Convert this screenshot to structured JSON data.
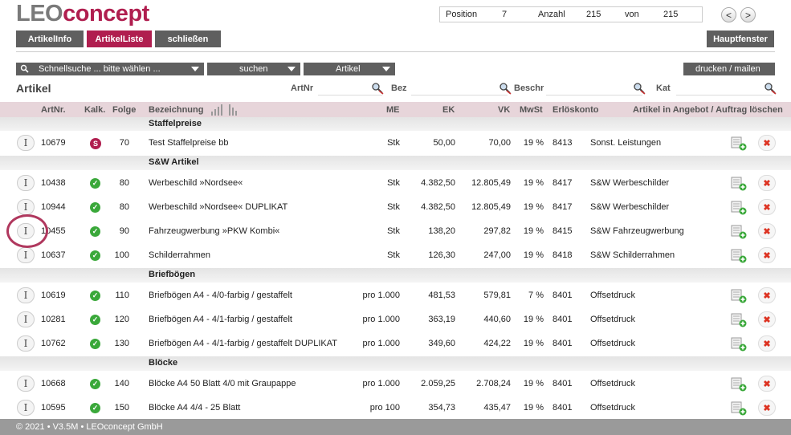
{
  "app": {
    "logo_part1": "LEO",
    "logo_part2": "concept"
  },
  "nav": {
    "position_label": "Position",
    "position_value": "7",
    "anzahl_label": "Anzahl",
    "anzahl_value": "215",
    "von_label": "von",
    "von_value": "215",
    "prev": "<",
    "next": ">"
  },
  "tabs": {
    "artikelinfo": "ArtikelInfo",
    "artikelliste": "ArtikelListe",
    "schliessen": "schließen",
    "hauptfenster": "Hauptfenster"
  },
  "toolbar": {
    "schnellsuche": "Schnellsuche ... bitte wählen ...",
    "suchen": "suchen",
    "artikel": "Artikel",
    "drucken": "drucken / mailen"
  },
  "search": {
    "title": "Artikel",
    "artnr": "ArtNr",
    "bez": "Bez",
    "beschr": "Beschr",
    "kat": "Kat"
  },
  "columns": {
    "artnr": "ArtNr.",
    "kalk": "Kalk.",
    "folge": "Folge",
    "bezeichnung": "Bezeichnung",
    "me": "ME",
    "ek": "EK",
    "vk": "VK",
    "mwst": "MwSt",
    "konto": "Erlöskonto",
    "actions": "Artikel in Angebot / Auftrag löschen"
  },
  "groups": [
    "Staffelpreise",
    "S&W Artikel",
    "Briefbögen",
    "Blöcke"
  ],
  "rows": [
    {
      "artnr": "10679",
      "kalk": "S",
      "folge": "70",
      "bez": "Test Staffelpreise bb",
      "me": "Stk",
      "ek": "50,00",
      "vk": "70,00",
      "mwst": "19 %",
      "konto": "8413",
      "kontoname": "Sonst. Leistungen"
    },
    {
      "artnr": "10438",
      "kalk": "check",
      "folge": "80",
      "bez": "Werbeschild »Nordsee«",
      "me": "Stk",
      "ek": "4.382,50",
      "vk": "12.805,49",
      "mwst": "19 %",
      "konto": "8417",
      "kontoname": "S&W Werbeschilder"
    },
    {
      "artnr": "10944",
      "kalk": "check",
      "folge": "80",
      "bez": "Werbeschild »Nordsee« DUPLIKAT",
      "me": "Stk",
      "ek": "4.382,50",
      "vk": "12.805,49",
      "mwst": "19 %",
      "konto": "8417",
      "kontoname": "S&W Werbeschilder"
    },
    {
      "artnr": "10455",
      "kalk": "check",
      "folge": "90",
      "bez": "Fahrzeugwerbung »PKW Kombi«",
      "me": "Stk",
      "ek": "138,20",
      "vk": "297,82",
      "mwst": "19 %",
      "konto": "8415",
      "kontoname": "S&W Fahrzeugwerbung"
    },
    {
      "artnr": "10637",
      "kalk": "check",
      "folge": "100",
      "bez": "Schilderrahmen",
      "me": "Stk",
      "ek": "126,30",
      "vk": "247,00",
      "mwst": "19 %",
      "konto": "8418",
      "kontoname": "S&W Schilderrahmen"
    },
    {
      "artnr": "10619",
      "kalk": "check",
      "folge": "110",
      "bez": "Briefbögen A4 - 4/0-farbig / gestaffelt",
      "me": "pro 1.000",
      "ek": "481,53",
      "vk": "579,81",
      "mwst": "7 %",
      "konto": "8401",
      "kontoname": "Offsetdruck"
    },
    {
      "artnr": "10281",
      "kalk": "check",
      "folge": "120",
      "bez": "Briefbögen A4 - 4/1-farbig / gestaffelt",
      "me": "pro 1.000",
      "ek": "363,19",
      "vk": "440,60",
      "mwst": "19 %",
      "konto": "8401",
      "kontoname": "Offsetdruck"
    },
    {
      "artnr": "10762",
      "kalk": "check",
      "folge": "130",
      "bez": "Briefbögen A4 - 4/1-farbig / gestaffelt DUPLIKAT",
      "me": "pro 1.000",
      "ek": "349,60",
      "vk": "424,22",
      "mwst": "19 %",
      "konto": "8401",
      "kontoname": "Offsetdruck"
    },
    {
      "artnr": "10668",
      "kalk": "check",
      "folge": "140",
      "bez": "Blöcke A4 50 Blatt 4/0 mit Graupappe",
      "me": "pro 1.000",
      "ek": "2.059,25",
      "vk": "2.708,24",
      "mwst": "19 %",
      "konto": "8401",
      "kontoname": "Offsetdruck"
    },
    {
      "artnr": "10595",
      "kalk": "check",
      "folge": "150",
      "bez": "Blöcke A4 4/4 - 25 Blatt",
      "me": "pro 100",
      "ek": "354,73",
      "vk": "435,47",
      "mwst": "19 %",
      "konto": "8401",
      "kontoname": "Offsetdruck"
    }
  ],
  "footer": "© 2021 • V3.5M • LEOconcept GmbH"
}
